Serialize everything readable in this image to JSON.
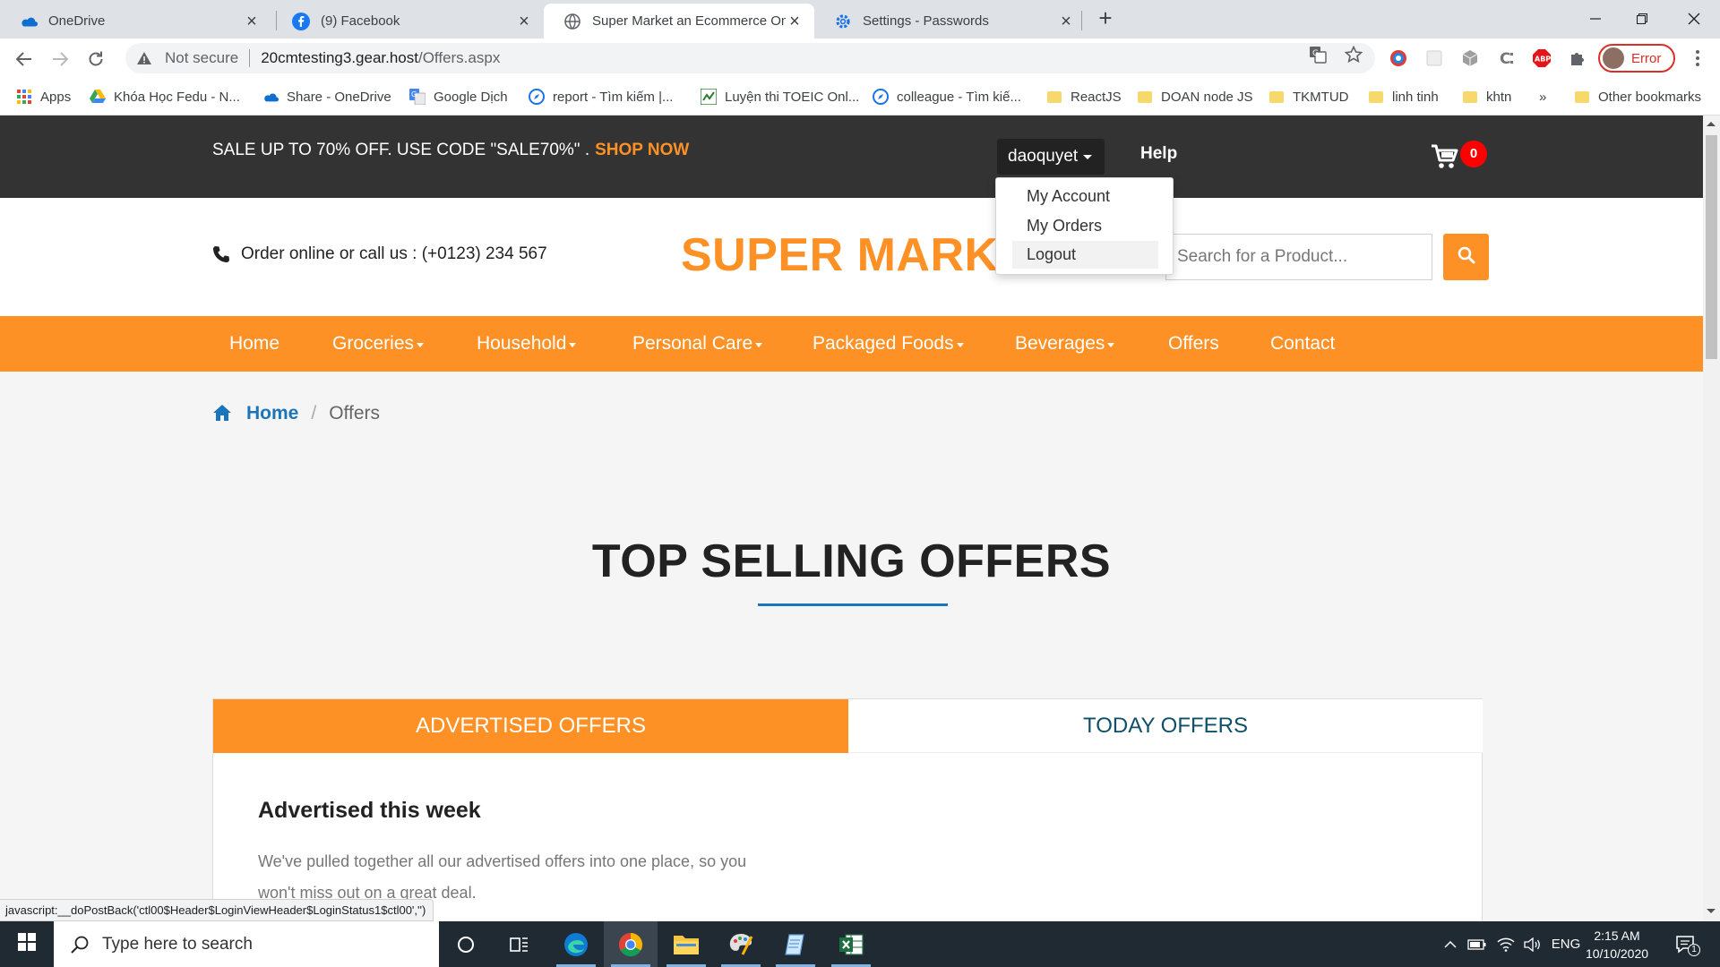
{
  "browser": {
    "tabs": [
      {
        "title": "OneDrive",
        "active": false
      },
      {
        "title": "(9) Facebook",
        "active": false
      },
      {
        "title": "Super Market an Ecommerce Onl",
        "active": true
      },
      {
        "title": "Settings - Passwords",
        "active": false
      }
    ],
    "address": {
      "security": "Not secure",
      "host": "20cmtesting3.gear.host",
      "path": "/Offers.aspx"
    },
    "profile_label": "Error",
    "bookmarks": [
      {
        "label": "Apps",
        "icon": "apps-grid-icon"
      },
      {
        "label": "Khóa Học Fedu - N...",
        "icon": "google-drive-icon"
      },
      {
        "label": "Share - OneDrive",
        "icon": "onedrive-icon"
      },
      {
        "label": "Google Dịch",
        "icon": "google-translate-icon"
      },
      {
        "label": "report - Tìm kiếm |...",
        "icon": "compass-icon"
      },
      {
        "label": "Luyện thi TOEIC Onl...",
        "icon": "toeic-icon"
      },
      {
        "label": "colleague - Tìm kiế...",
        "icon": "compass-icon"
      },
      {
        "label": "ReactJS",
        "icon": "folder-icon"
      },
      {
        "label": "DOAN node JS",
        "icon": "folder-icon"
      },
      {
        "label": "TKMTUD",
        "icon": "folder-icon"
      },
      {
        "label": "linh tinh",
        "icon": "folder-icon"
      },
      {
        "label": "khtn",
        "icon": "folder-icon"
      },
      {
        "label": "»",
        "icon": ""
      },
      {
        "label": "Other bookmarks",
        "icon": "folder-icon"
      }
    ],
    "status_url": "javascript:__doPostBack('ctl00$Header$LoginViewHeader$LoginStatus1$ctl00','')"
  },
  "site": {
    "colors": {
      "accent": "#fe9126",
      "dark": "#333333",
      "link": "#1a75bb",
      "tab_text": "#0e4f6a"
    },
    "promo": {
      "text": "SALE UP TO 70% OFF. USE CODE \"SALE70%\" .",
      "cta": "SHOP NOW"
    },
    "user": {
      "name": "daoquyet",
      "menu": [
        "My Account",
        "My Orders",
        "Logout"
      ],
      "hovered": "Logout"
    },
    "help": "Help",
    "cart_count": "0",
    "phone": "Order online or call us : (+0123) 234 567",
    "logo": "SUPER MARKET",
    "search_placeholder": "Search for a Product...",
    "nav": [
      {
        "label": "Home",
        "dropdown": false
      },
      {
        "label": "Groceries",
        "dropdown": true
      },
      {
        "label": "Household",
        "dropdown": true
      },
      {
        "label": "Personal Care",
        "dropdown": true
      },
      {
        "label": "Packaged Foods",
        "dropdown": true
      },
      {
        "label": "Beverages",
        "dropdown": true
      },
      {
        "label": "Offers",
        "dropdown": false
      },
      {
        "label": "Contact",
        "dropdown": false
      }
    ],
    "breadcrumb": {
      "home": "Home",
      "current": "Offers"
    },
    "section_title": "TOP SELLING OFFERS",
    "offer_tabs": [
      {
        "label": "ADVERTISED OFFERS",
        "active": true
      },
      {
        "label": "TODAY OFFERS",
        "active": false
      }
    ],
    "advertised": {
      "heading": "Advertised this week",
      "text": "We've pulled together all our advertised offers into one place, so you won't miss out on a great deal."
    }
  },
  "taskbar": {
    "search_placeholder": "Type here to search",
    "language": "ENG",
    "time": "2:15 AM",
    "date": "10/10/2020",
    "notifications": "1"
  }
}
